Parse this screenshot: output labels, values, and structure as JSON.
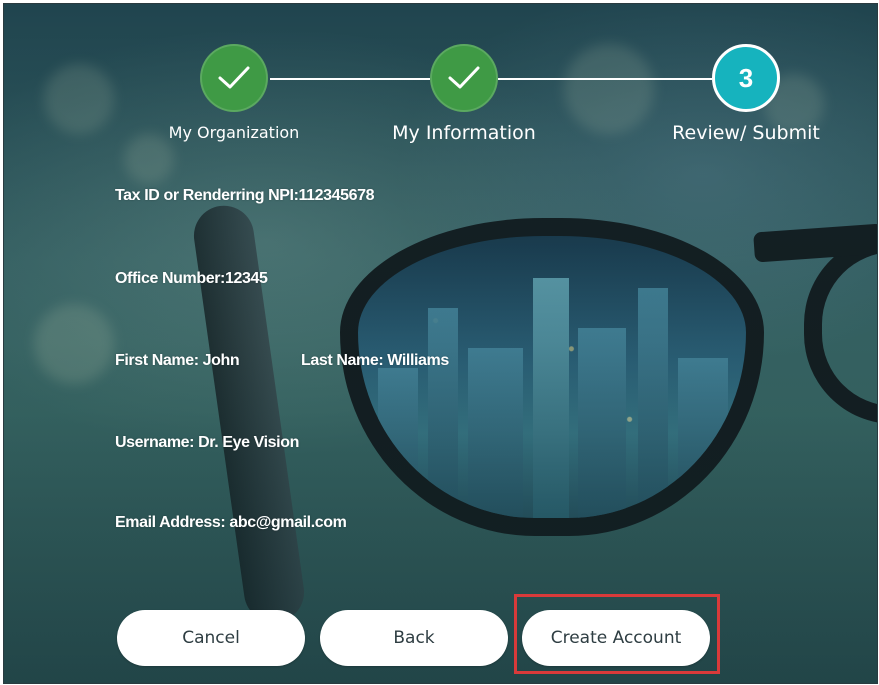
{
  "stepper": {
    "steps": [
      {
        "label": "My Organization",
        "status": "complete"
      },
      {
        "label": "My Information",
        "status": "complete"
      },
      {
        "label": "Review/ Submit",
        "status": "current",
        "number": "3"
      }
    ],
    "colors": {
      "complete": "#3f9a45",
      "current": "#16b3be"
    }
  },
  "review": {
    "tax_id": "Tax ID or Renderring NPI:112345678",
    "office_number": "Office Number:12345",
    "first_name": "First Name: John",
    "last_name": "Last Name: Williams",
    "username": "Username: Dr. Eye Vision",
    "email": "Email Address: abc@gmail.com"
  },
  "actions": {
    "cancel_label": "Cancel",
    "back_label": "Back",
    "create_label": "Create Account",
    "highlight_color": "#d93a3a"
  }
}
